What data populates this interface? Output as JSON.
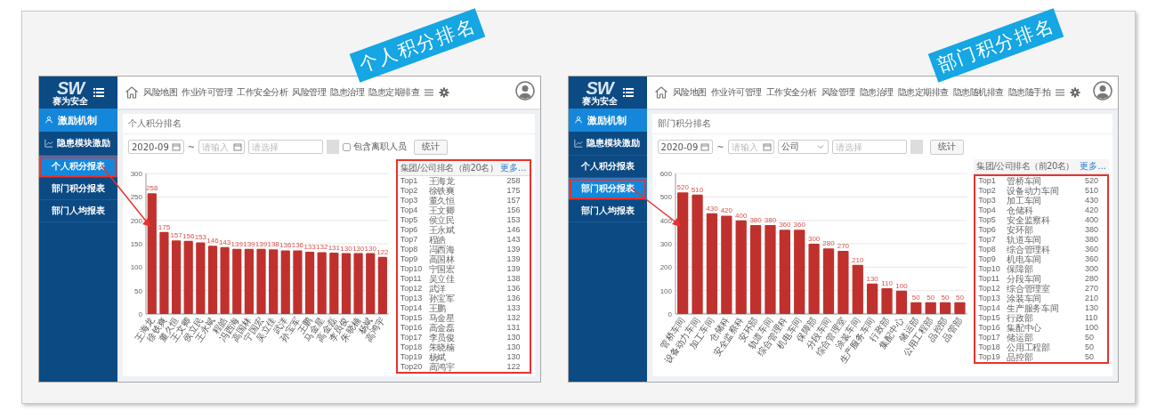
{
  "panels": [
    {
      "callout": "个人积分排名",
      "logo": {
        "mark": "SW",
        "name": "赛为安全"
      },
      "sidebar": {
        "section": "激励机制",
        "group": "隐患模块激励",
        "items": [
          {
            "label": "个人积分报表",
            "selected": true,
            "annotated": true
          },
          {
            "label": "部门积分报表",
            "selected": false,
            "annotated": false
          },
          {
            "label": "部门人均报表",
            "selected": false,
            "annotated": false
          }
        ]
      },
      "nav": [
        "风险地图",
        "作业许可管理",
        "工作安全分析",
        "风险管理",
        "隐患治理",
        "隐患定期排查"
      ],
      "page_title": "个人积分排名",
      "filters": {
        "start": "2020-09",
        "separator": "~",
        "end_placeholder": "请输入",
        "select_placeholder": "请选择",
        "checkbox": {
          "label": "包含离职人员",
          "checked": false
        },
        "button": "统计"
      },
      "ranking": {
        "title": "集团/公司排名（前20名）",
        "more": "更多...",
        "outlined": true,
        "rows_outlined": false,
        "rows": [
          {
            "rank": "Top1",
            "name": "王海龙",
            "score": "258"
          },
          {
            "rank": "Top2",
            "name": "徐铁爽",
            "score": "175"
          },
          {
            "rank": "Top3",
            "name": "董久恒",
            "score": "157"
          },
          {
            "rank": "Top4",
            "name": "王文卿",
            "score": "156"
          },
          {
            "rank": "Top5",
            "name": "侯立民",
            "score": "153"
          },
          {
            "rank": "Top6",
            "name": "王永斌",
            "score": "146"
          },
          {
            "rank": "Top7",
            "name": "程皓",
            "score": "143"
          },
          {
            "rank": "Top8",
            "name": "冯西海",
            "score": "139"
          },
          {
            "rank": "Top9",
            "name": "高国林",
            "score": "139"
          },
          {
            "rank": "Top10",
            "name": "宁国宏",
            "score": "139"
          },
          {
            "rank": "Top11",
            "name": "吴立佳",
            "score": "138"
          },
          {
            "rank": "Top12",
            "name": "武洋",
            "score": "136"
          },
          {
            "rank": "Top13",
            "name": "孙宝军",
            "score": "136"
          },
          {
            "rank": "Top14",
            "name": "王鹏",
            "score": "133"
          },
          {
            "rank": "Top15",
            "name": "马金星",
            "score": "132"
          },
          {
            "rank": "Top16",
            "name": "高金磊",
            "score": "131"
          },
          {
            "rank": "Top17",
            "name": "李员俊",
            "score": "130"
          },
          {
            "rank": "Top18",
            "name": "朱晓楠",
            "score": "130"
          },
          {
            "rank": "Top19",
            "name": "杨斌",
            "score": "130"
          },
          {
            "rank": "Top20",
            "name": "高鸿宇",
            "score": "122"
          }
        ]
      },
      "chart_data": {
        "type": "bar",
        "categories": [
          "王海龙",
          "徐铁爽",
          "董久恒",
          "王文卿",
          "侯立民",
          "王永斌",
          "程皓",
          "冯西海",
          "高国林",
          "宁国宏",
          "吴立佳",
          "武洋",
          "孙宝军",
          "王鹏",
          "马金星",
          "高金磊",
          "李员俊",
          "朱晓楠",
          "杨斌",
          "高鸿宇"
        ],
        "values": [
          258,
          175,
          157,
          156,
          153,
          146,
          143,
          139,
          139,
          139,
          138,
          136,
          136,
          133,
          132,
          131,
          130,
          130,
          130,
          122
        ],
        "ylim": [
          0,
          300
        ],
        "yticks": [
          0,
          50,
          100,
          150,
          200,
          250,
          300
        ],
        "grid": true,
        "data_labels": true
      }
    },
    {
      "callout": "部门积分排名",
      "logo": {
        "mark": "SW",
        "name": "赛为安全"
      },
      "sidebar": {
        "section": "激励机制",
        "group": "隐患模块激励",
        "items": [
          {
            "label": "个人积分报表",
            "selected": false,
            "annotated": false
          },
          {
            "label": "部门积分报表",
            "selected": true,
            "annotated": true
          },
          {
            "label": "部门人均报表",
            "selected": false,
            "annotated": false
          }
        ]
      },
      "nav": [
        "风险地图",
        "作业许可管理",
        "工作安全分析",
        "风险管理",
        "隐患治理",
        "隐患定期排查",
        "隐患随机排查",
        "隐患随手拍"
      ],
      "page_title": "部门积分排名",
      "filters": {
        "start": "2020-09",
        "separator": "~",
        "end_placeholder": "请输入",
        "scope": "公司",
        "select_placeholder": "请选择",
        "button": "统计"
      },
      "ranking": {
        "title": "集团/公司排名（前20名）",
        "more": "更多...",
        "outlined": false,
        "rows_outlined": true,
        "rows": [
          {
            "rank": "Top1",
            "name": "管桥车间",
            "score": "520"
          },
          {
            "rank": "Top2",
            "name": "设备动力车间",
            "score": "510"
          },
          {
            "rank": "Top3",
            "name": "加工车间",
            "score": "430"
          },
          {
            "rank": "Top4",
            "name": "仓储科",
            "score": "420"
          },
          {
            "rank": "Top5",
            "name": "安全监察科",
            "score": "400"
          },
          {
            "rank": "Top6",
            "name": "安环部",
            "score": "380"
          },
          {
            "rank": "Top7",
            "name": "轨道车间",
            "score": "380"
          },
          {
            "rank": "Top8",
            "name": "综合管理科",
            "score": "360"
          },
          {
            "rank": "Top9",
            "name": "机电车间",
            "score": "360"
          },
          {
            "rank": "Top10",
            "name": "保障部",
            "score": "300"
          },
          {
            "rank": "Top11",
            "name": "分段车间",
            "score": "280"
          },
          {
            "rank": "Top12",
            "name": "综合管理室",
            "score": "270"
          },
          {
            "rank": "Top13",
            "name": "涂装车间",
            "score": "210"
          },
          {
            "rank": "Top14",
            "name": "生产服务车间",
            "score": "130"
          },
          {
            "rank": "Top15",
            "name": "行政部",
            "score": "110"
          },
          {
            "rank": "Top16",
            "name": "集配中心",
            "score": "100"
          },
          {
            "rank": "Top17",
            "name": "储运部",
            "score": "50"
          },
          {
            "rank": "Top18",
            "name": "公用工程部",
            "score": "50"
          },
          {
            "rank": "Top19",
            "name": "品控部",
            "score": "50"
          }
        ]
      },
      "chart_data": {
        "type": "bar",
        "categories": [
          "管桥车间",
          "设备动力车间",
          "加工车间",
          "仓储科",
          "安全监察科",
          "安环部",
          "轨道车间",
          "综合管理科",
          "机电车间",
          "保障部",
          "分段车间",
          "综合管理室",
          "涂装车间",
          "生产服务车间",
          "行政部",
          "集配中心",
          "储运部",
          "公用工程部",
          "品控部",
          "品管部"
        ],
        "values": [
          520,
          510,
          430,
          420,
          400,
          380,
          380,
          360,
          360,
          300,
          280,
          270,
          210,
          130,
          110,
          100,
          50,
          50,
          50,
          50
        ],
        "ylim": [
          0,
          600
        ],
        "yticks": [
          0,
          100,
          200,
          300,
          400,
          500,
          600
        ],
        "grid": true,
        "data_labels": true
      }
    }
  ]
}
